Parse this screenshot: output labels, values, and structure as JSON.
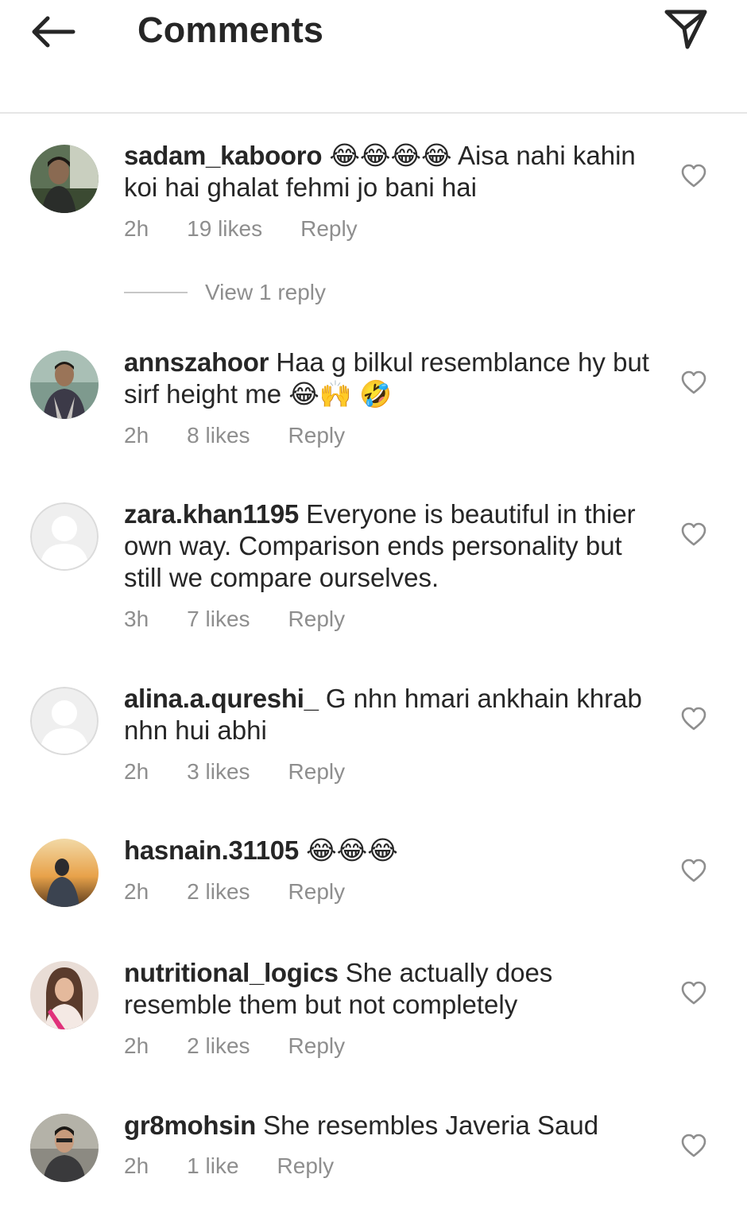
{
  "header": {
    "title": "Comments",
    "back_icon": "arrow-left-icon",
    "send_icon": "paper-plane-icon",
    "cutoff_text": "..."
  },
  "comments": [
    {
      "username": "sadam_kabooro",
      "text": "😂😂😂😂 Aisa nahi kahin koi hai ghalat fehmi jo bani hai",
      "time": "2h",
      "likes": "19 likes",
      "reply": "Reply",
      "view_replies": "View 1 reply"
    },
    {
      "username": "annszahoor",
      "text": "Haa g bilkul resemblance hy but sirf height me 😂🙌 🤣",
      "time": "2h",
      "likes": "8 likes",
      "reply": "Reply"
    },
    {
      "username": "zara.khan1195",
      "text": "Everyone is beautiful in thier own way. Comparison ends personality but still we compare ourselves.",
      "time": "3h",
      "likes": "7 likes",
      "reply": "Reply"
    },
    {
      "username": "alina.a.qureshi_",
      "text": "G nhn hmari ankhain khrab nhn hui abhi",
      "time": "2h",
      "likes": "3 likes",
      "reply": "Reply"
    },
    {
      "username": "hasnain.31105",
      "text": "😂😂😂",
      "time": "2h",
      "likes": "2 likes",
      "reply": "Reply"
    },
    {
      "username": "nutritional_logics",
      "text": "She actually does resemble them but not completely",
      "time": "2h",
      "likes": "2 likes",
      "reply": "Reply"
    },
    {
      "username": "gr8mohsin",
      "text": "She resembles Javeria Saud",
      "time": "2h",
      "likes": "1 like",
      "reply": "Reply"
    }
  ],
  "colors": {
    "text": "#262626",
    "secondary": "#8e8e8e",
    "divider": "#e6e6e6"
  }
}
